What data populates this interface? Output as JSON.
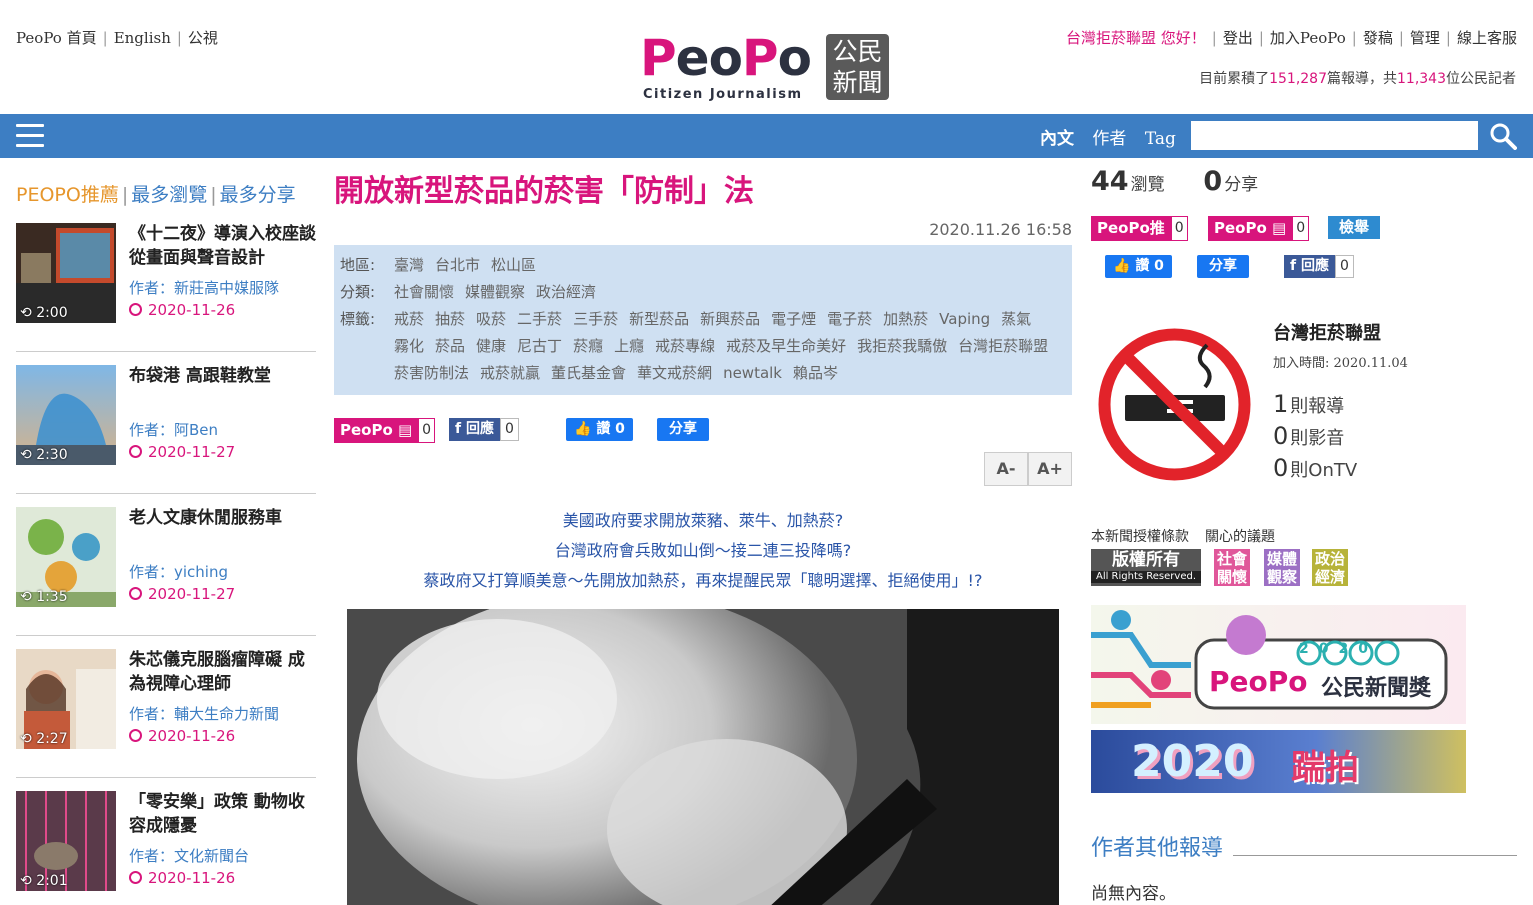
{
  "top_links": [
    "PeoPo 首頁",
    "English",
    "公視"
  ],
  "logo": {
    "wordmark": "PeoPo",
    "subtitle": "Citizen Journalism",
    "box_line1": "公民",
    "box_line2": "新聞"
  },
  "user_menu": {
    "greeting": "台灣拒菸聯盟 您好！",
    "items": [
      "登出",
      "加入PeoPo",
      "發稿",
      "管理",
      "線上客服"
    ]
  },
  "site_stats": {
    "prefix": "目前累積了",
    "reports": "151,287",
    "middle": "篇報導，共",
    "reporters": "11,343",
    "suffix": "位公民記者"
  },
  "nav": {
    "tabs": [
      "內文",
      "作者",
      "Tag"
    ],
    "search_placeholder": ""
  },
  "left": {
    "tabs": [
      "PEOPO推薦",
      "最多瀏覽",
      "最多分享"
    ],
    "items": [
      {
        "title": "《十二夜》導演入校座談 從畫面與聲音設計",
        "author": "作者：新莊高中媒服隊",
        "date": "2020-11-26",
        "duration": "2:00"
      },
      {
        "title": "布袋港 高跟鞋教堂",
        "author": "作者：阿Ben",
        "date": "2020-11-27",
        "duration": "2:30"
      },
      {
        "title": "老人文康休閒服務車",
        "author": "作者：yiching",
        "date": "2020-11-27",
        "duration": "1:35"
      },
      {
        "title": "朱芯儀克服腦瘤障礙 成為視障心理師",
        "author": "作者：輔大生命力新聞",
        "date": "2020-11-26",
        "duration": "2:27"
      },
      {
        "title": "「零安樂」政策 動物收容成隱憂",
        "author": "作者：文化新聞台",
        "date": "2020-11-26",
        "duration": "2:01"
      }
    ]
  },
  "article": {
    "title": "開放新型菸品的菸害「防制」法",
    "datetime": "2020.11.26 16:58",
    "region_label": "地區:",
    "regions": [
      "臺灣",
      "台北市",
      "松山區"
    ],
    "category_label": "分類:",
    "categories": [
      "社會關懷",
      "媒體觀察",
      "政治經濟"
    ],
    "tag_label": "標籤:",
    "tags": [
      "戒菸",
      "抽菸",
      "吸菸",
      "二手菸",
      "三手菸",
      "新型菸品",
      "新興菸品",
      "電子煙",
      "電子菸",
      "加熱菸",
      "Vaping",
      "蒸氣",
      "霧化",
      "菸品",
      "健康",
      "尼古丁",
      "菸癮",
      "上癮",
      "戒菸專線",
      "戒菸及早生命美好",
      "我拒菸我驕傲",
      "台灣拒菸聯盟",
      "菸害防制法",
      "戒菸就贏",
      "董氏基金會",
      "華文戒菸網",
      "newtalk",
      "賴品岑"
    ],
    "peopo_count": "0",
    "reply_label": "回應",
    "reply_count": "0",
    "like_label": "讚 0",
    "share_label": "分享",
    "font_smaller": "A-",
    "font_larger": "A+",
    "lede": [
      "美國政府要求開放萊豬、萊牛、加熱菸?",
      "台灣政府會兵敗如山倒～接二連三投降嗎?",
      "蔡政府又打算順美意～先開放加熱菸，再來提醒民眾「聰明選擇、拒絕使用」!?"
    ]
  },
  "right": {
    "views": "44",
    "views_label": "瀏覽",
    "shares": "0",
    "shares_label": "分享",
    "push_label": "PeoPo推",
    "push_count": "0",
    "comment_label": "PeoPo",
    "comment_count": "0",
    "report_label": "檢舉",
    "fb_like": "讚 0",
    "fb_share": "分享",
    "fb_reply": "回應",
    "fb_reply_count": "0",
    "author_name": "台灣拒菸聯盟",
    "join_date": "加入時間: 2020.11.04",
    "reports": "1",
    "reports_label": "則報導",
    "videos": "0",
    "videos_label": "則影音",
    "ontv": "0",
    "ontv_label": "則OnTV",
    "license_label": "本新聞授權條款",
    "topics_label": "關心的議題",
    "rights": "版權所有",
    "rights_sub": "All Rights Reserved.",
    "topics": [
      {
        "text": "社會關懷",
        "color": "#e0579a"
      },
      {
        "text": "媒體觀察",
        "color": "#9c6fc4"
      },
      {
        "text": "政治經濟",
        "color": "#b7b33a"
      }
    ],
    "award_year": "2020",
    "award_text": "公民新聞獎",
    "banner_text": "2020",
    "banner_text2": "踹拍",
    "other_title": "作者其他報導",
    "other_empty": "尚無內容。"
  }
}
